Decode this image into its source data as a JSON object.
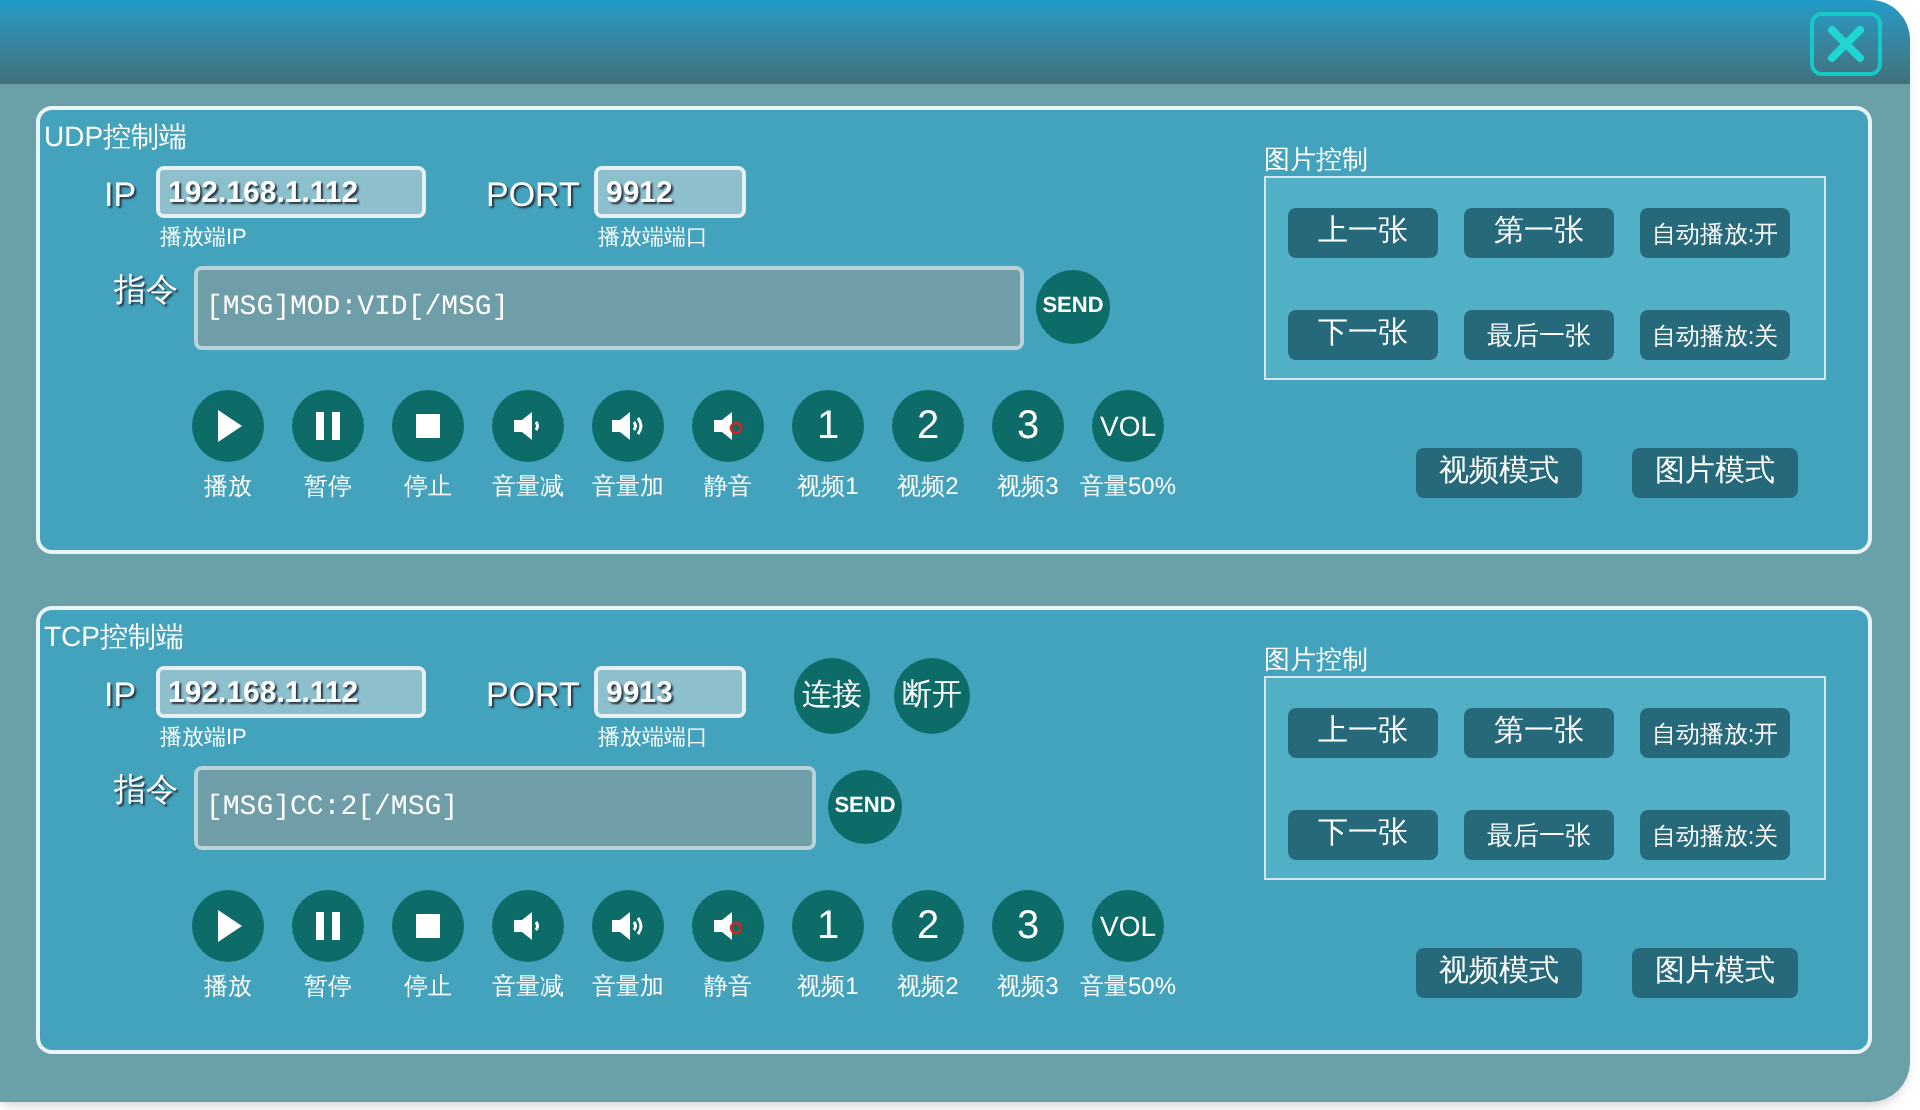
{
  "panels": [
    {
      "title": "UDP控制端",
      "ip_label": "IP",
      "ip": "192.168.1.112",
      "ip_hint": "播放端IP",
      "port_label": "PORT",
      "port": "9912",
      "port_hint": "播放端端口",
      "command_label": "指令",
      "command": "[MSG]MOD:VID[/MSG]",
      "command_wide": true,
      "send": "SEND",
      "media": [
        {
          "kind": "play",
          "label": "播放"
        },
        {
          "kind": "pause",
          "label": "暂停"
        },
        {
          "kind": "stop",
          "label": "停止"
        },
        {
          "kind": "vol_down",
          "label": "音量减"
        },
        {
          "kind": "vol_up",
          "label": "音量加"
        },
        {
          "kind": "mute",
          "label": "静音"
        },
        {
          "kind": "text",
          "glyph": "1",
          "label": "视频1"
        },
        {
          "kind": "text",
          "glyph": "2",
          "label": "视频2"
        },
        {
          "kind": "text",
          "glyph": "3",
          "label": "视频3"
        },
        {
          "kind": "text",
          "glyph": "VOL",
          "label": "音量50%"
        }
      ],
      "image_control": {
        "title": "图片控制",
        "buttons": [
          "上一张",
          "第一张",
          "自动播放:开",
          "下一张",
          "最后一张",
          "自动播放:关"
        ]
      },
      "mode_buttons": [
        "视频模式",
        "图片模式"
      ]
    },
    {
      "title": "TCP控制端",
      "ip_label": "IP",
      "ip": "192.168.1.112",
      "ip_hint": "播放端IP",
      "port_label": "PORT",
      "port": "9913",
      "port_hint": "播放端端口",
      "connect_buttons": [
        "连接",
        "断开"
      ],
      "command_label": "指令",
      "command": "[MSG]CC:2[/MSG]",
      "command_wide": false,
      "send": "SEND",
      "media": [
        {
          "kind": "play",
          "label": "播放"
        },
        {
          "kind": "pause",
          "label": "暂停"
        },
        {
          "kind": "stop",
          "label": "停止"
        },
        {
          "kind": "vol_down",
          "label": "音量减"
        },
        {
          "kind": "vol_up",
          "label": "音量加"
        },
        {
          "kind": "mute",
          "label": "静音"
        },
        {
          "kind": "text",
          "glyph": "1",
          "label": "视频1"
        },
        {
          "kind": "text",
          "glyph": "2",
          "label": "视频2"
        },
        {
          "kind": "text",
          "glyph": "3",
          "label": "视频3"
        },
        {
          "kind": "text",
          "glyph": "VOL",
          "label": "音量50%"
        }
      ],
      "image_control": {
        "title": "图片控制",
        "buttons": [
          "上一张",
          "第一张",
          "自动播放:开",
          "下一张",
          "最后一张",
          "自动播放:关"
        ]
      },
      "mode_buttons": [
        "视频模式",
        "图片模式"
      ]
    }
  ]
}
